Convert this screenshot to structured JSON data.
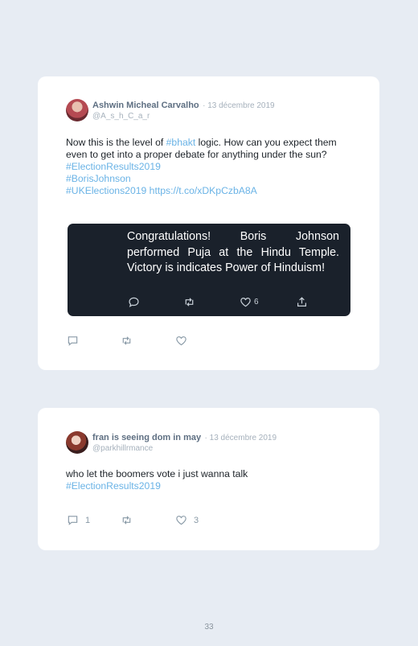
{
  "tweets": [
    {
      "author_name": "Ashwin Micheal Carvalho",
      "date": "· 13 décembre 2019",
      "handle": "@A_s_h_C_a_r",
      "text_before": "Now this is the level of ",
      "text_link": "#bhakt",
      "text_after": " logic. How can you expect them even to get into a proper debate for anything under the sun?",
      "hashtags": [
        "#ElectionResults2019",
        "#BorisJohnson",
        "#UKElections2019"
      ],
      "url": "https://t.co/xDKpCzbA8A",
      "quoted": {
        "text": "Congratulations! Boris Johnson performed Puja at the Hindu Temple. Victory is indicates Power of Hinduism!",
        "likes": "6"
      },
      "actions": {
        "reply_icon": "reply-icon",
        "retweet_icon": "retweet-icon",
        "like_icon": "heart-icon"
      }
    },
    {
      "author_name": "fran is seeing dom in may",
      "date": "· 13 décembre 2019",
      "handle": "@parkhillrmance",
      "text": "who let the boomers vote i just wanna talk",
      "hashtag": "#ElectionResults2019",
      "replies": "1",
      "likes": "3"
    }
  ],
  "page_number": "33"
}
